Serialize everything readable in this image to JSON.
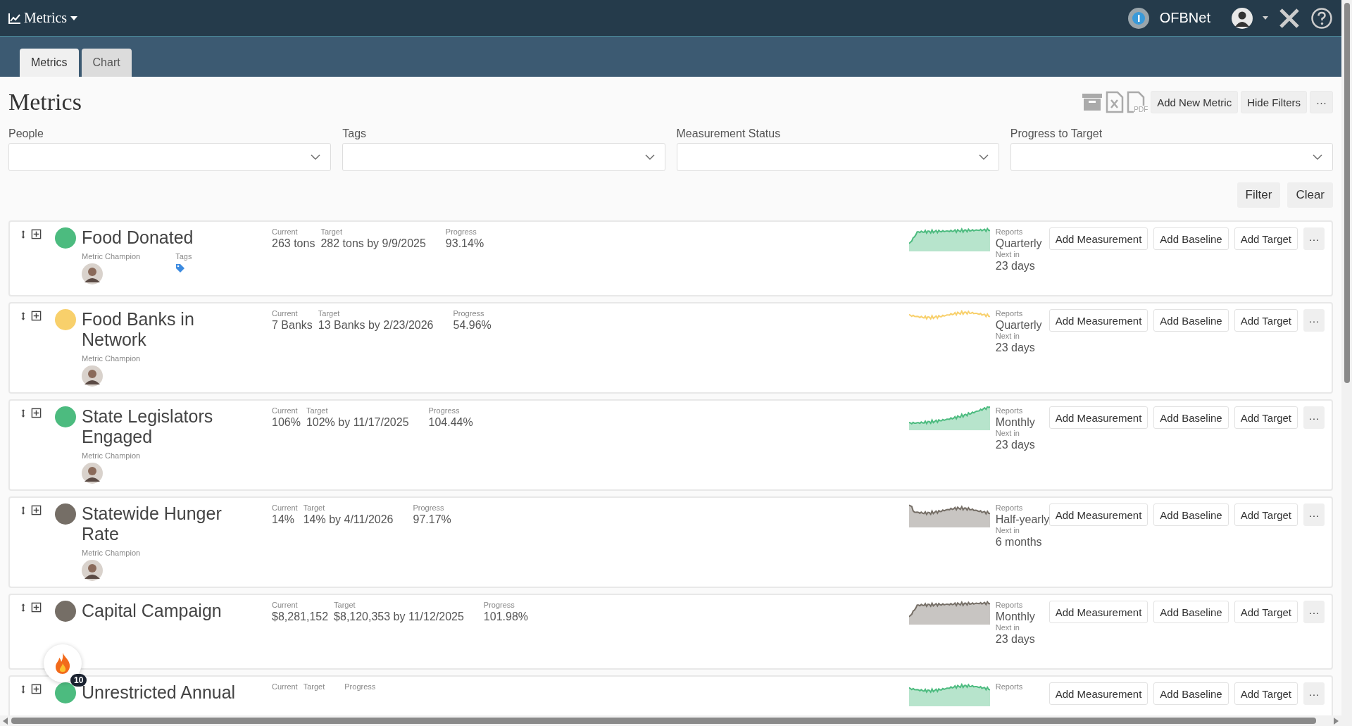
{
  "app_menu": {
    "title": "Metrics"
  },
  "user_bar": {
    "org": "OFBNet"
  },
  "tabs": [
    {
      "label": "Metrics",
      "selected": true
    },
    {
      "label": "Chart",
      "selected": false
    }
  ],
  "page_title": "Metrics",
  "export_icons": {
    "pdf_label": "PDF"
  },
  "toolbar_buttons": [
    "Add New Metric",
    "Hide Filters",
    "···"
  ],
  "filters": [
    {
      "label": "People"
    },
    {
      "label": "Tags"
    },
    {
      "label": "Measurement Status"
    },
    {
      "label": "Progress to Target"
    }
  ],
  "filter_buttons": [
    "Filter",
    "Clear"
  ],
  "metrics": [
    {
      "name": "Food Donated",
      "color": "#4cbb7f",
      "champion_label": "Metric Champion",
      "tags_label": "Tags",
      "current": {
        "label": "Current",
        "value": "263 tons"
      },
      "target": {
        "label": "Target",
        "value": "282 tons by 9/9/2025"
      },
      "progress": {
        "label": "Progress",
        "value": "93.14%"
      },
      "kind": "area",
      "reports": {
        "label": "Reports",
        "value": "Quarterly"
      },
      "next_in": {
        "label": "Next in",
        "value": "23 days"
      },
      "buttons": [
        "Add Measurement",
        "Add Baseline",
        "Add Target",
        "···"
      ]
    },
    {
      "name": "Food Banks in Network",
      "color": "#f8d06b",
      "champion_label": "Metric Champion",
      "current": {
        "label": "Current",
        "value": "7 Banks"
      },
      "target": {
        "label": "Target",
        "value": "13 Banks by 2/23/2026"
      },
      "progress": {
        "label": "Progress",
        "value": "54.96%"
      },
      "kind": "line",
      "reports": {
        "label": "Reports",
        "value": "Quarterly"
      },
      "next_in": {
        "label": "Next in",
        "value": "23 days"
      },
      "buttons": [
        "Add Measurement",
        "Add Baseline",
        "Add Target",
        "···"
      ]
    },
    {
      "name": "State Legislators Engaged",
      "color": "#4cbb7f",
      "champion_label": "Metric Champion",
      "current": {
        "label": "Current",
        "value": "106%"
      },
      "target": {
        "label": "Target",
        "value": "102% by 11/17/2025"
      },
      "progress": {
        "label": "Progress",
        "value": "104.44%"
      },
      "kind": "area",
      "reports": {
        "label": "Reports",
        "value": "Monthly"
      },
      "next_in": {
        "label": "Next in",
        "value": "23 days"
      },
      "buttons": [
        "Add Measurement",
        "Add Baseline",
        "Add Target",
        "···"
      ]
    },
    {
      "name": "Statewide Hunger Rate",
      "color": "#756e66",
      "champion_label": "Metric Champion",
      "current": {
        "label": "Current",
        "value": "14%"
      },
      "target": {
        "label": "Target",
        "value": "14% by 4/11/2026"
      },
      "progress": {
        "label": "Progress",
        "value": "97.17%"
      },
      "kind": "area",
      "reports": {
        "label": "Reports",
        "value": "Half-yearly"
      },
      "next_in": {
        "label": "Next in",
        "value": "6 months"
      },
      "buttons": [
        "Add Measurement",
        "Add Baseline",
        "Add Target",
        "···"
      ]
    },
    {
      "name": "Capital Campaign",
      "color": "#756e66",
      "current": {
        "label": "Current",
        "value": "$8,281,152"
      },
      "target": {
        "label": "Target",
        "value": "$8,120,353 by 11/12/2025"
      },
      "progress": {
        "label": "Progress",
        "value": "101.98%"
      },
      "kind": "area",
      "reports": {
        "label": "Reports",
        "value": "Monthly"
      },
      "next_in": {
        "label": "Next in",
        "value": "23 days"
      },
      "buttons": [
        "Add Measurement",
        "Add Baseline",
        "Add Target",
        "···"
      ]
    },
    {
      "name": "Unrestricted Annual",
      "color": "#4cbb7f",
      "current": {
        "label": "Current"
      },
      "target": {
        "label": "Target"
      },
      "progress": {
        "label": "Progress"
      },
      "kind": "area",
      "reports": {
        "label": "Reports"
      },
      "buttons": [
        "Add Measurement",
        "Add Baseline",
        "Add Target",
        "···"
      ]
    }
  ],
  "streak_badge": {
    "count": "10"
  }
}
